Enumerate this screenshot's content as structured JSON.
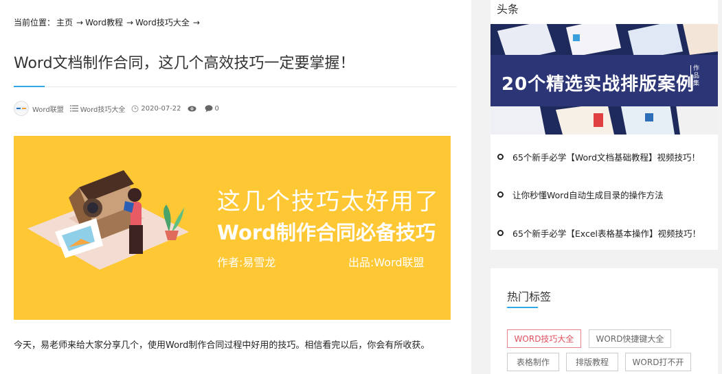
{
  "breadcrumb": {
    "label": "当前位置：",
    "items": [
      "主页",
      "Word教程",
      "Word技巧大全"
    ],
    "separator": "→"
  },
  "article": {
    "title": "Word文档制作合同，这几个高效技巧一定要掌握！",
    "author": "Word联盟",
    "category": "Word技巧大全",
    "date": "2020-07-22",
    "comments": "0",
    "banner": {
      "line1": "这几个技巧太好用了",
      "line2": "Word制作合同必备技巧",
      "author": "作者:易雪龙",
      "source": "出品:Word联盟",
      "background": "#fec734"
    },
    "intro": "今天，易老师来给大家分享几个，使用Word制作合同过程中好用的技巧。相信看完以后，你会有所收获。"
  },
  "sidebar": {
    "headline_title": "头条",
    "headline_banner_text": "20个精选实战排版案例",
    "headline_banner_tag": "作品集",
    "news": [
      "65个新手必学【Word文档基础教程】视频技巧！",
      "让你秒懂Word自动生成目录的操作方法",
      "65个新手必学【Excel表格基本操作】视频技巧！"
    ],
    "tags_title": "热门标签",
    "tags": [
      "WORD技巧大全",
      "WORD快捷键大全",
      "表格制作",
      "排版教程",
      "WORD打不开"
    ]
  },
  "colors": {
    "accent": "#2ea8e6",
    "active_tag": "#e0505e"
  }
}
